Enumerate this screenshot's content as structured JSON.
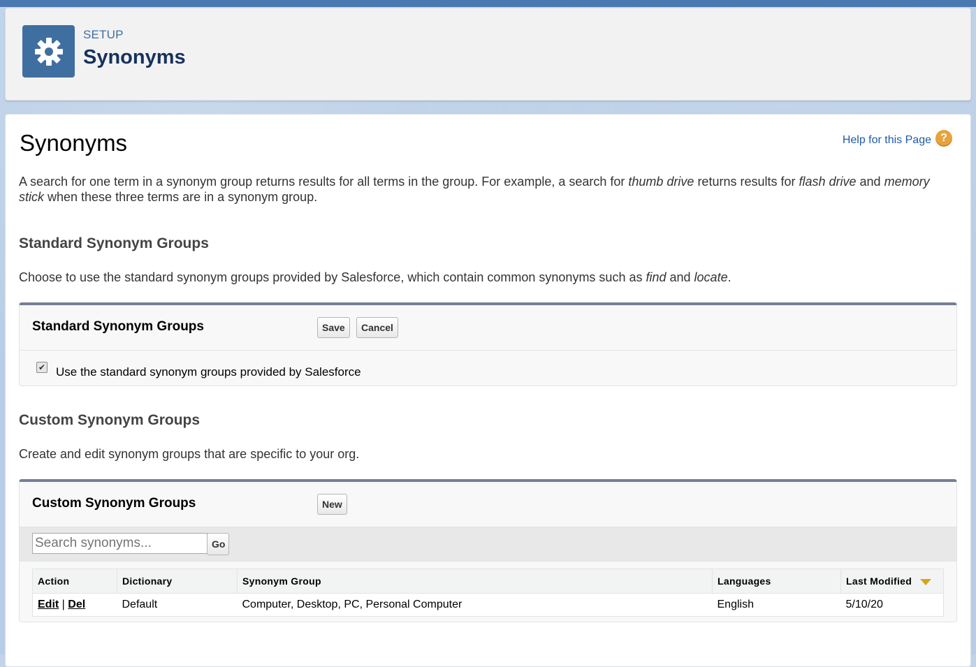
{
  "header": {
    "icon": "gear-icon",
    "setup_label": "SETUP",
    "title": "Synonyms"
  },
  "page": {
    "title": "Synonyms",
    "help_link": "Help for this Page",
    "help_icon": "?",
    "intro": {
      "p1": "A search for one term in a synonym group returns results for all terms in the group. For example, a search for ",
      "t1": "thumb drive",
      "p2": " returns results for ",
      "t2": "flash drive",
      "p3": " and ",
      "t3": "memory stick",
      "p4": " when these three terms are in a synonym group."
    }
  },
  "standard": {
    "heading": "Standard Synonym Groups",
    "desc_prefix": "Choose to use the standard synonym groups provided by Salesforce, which contain common synonyms such as ",
    "desc_t1": "find",
    "desc_mid": " and ",
    "desc_t2": "locate",
    "desc_suffix": ".",
    "block_title": "Standard Synonym Groups",
    "save_label": "Save",
    "cancel_label": "Cancel",
    "checkbox_checked": true,
    "checkbox_label": "Use the standard synonym groups provided by Salesforce"
  },
  "custom": {
    "heading": "Custom Synonym Groups",
    "desc": "Create and edit synonym groups that are specific to your org.",
    "block_title": "Custom Synonym Groups",
    "new_label": "New",
    "search_placeholder": "Search synonyms...",
    "go_label": "Go",
    "columns": [
      "Action",
      "Dictionary",
      "Synonym Group",
      "Languages",
      "Last Modified"
    ],
    "rows": [
      {
        "edit": "Edit",
        "sep": "|",
        "del": "Del",
        "dictionary": "Default",
        "synonym_group": "Computer, Desktop, PC, Personal Computer",
        "languages": "English",
        "last_modified": "5/10/20"
      }
    ]
  },
  "colors": {
    "accent": "#3f6fa0",
    "link": "#1f5ba6",
    "help_icon": "#e8a33c",
    "block_border": "#747e96"
  }
}
